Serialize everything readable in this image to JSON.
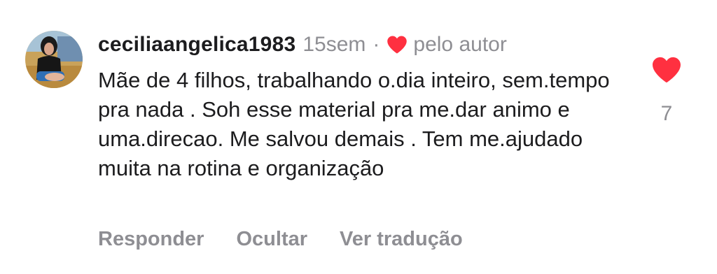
{
  "comment": {
    "username": "ceciliaangelica1983",
    "time": "15sem",
    "separator": "·",
    "liked_by_author": "pelo autor",
    "text": "Mãe de 4 filhos, trabalhando o.dia inteiro, sem.tempo pra nada . Soh esse material pra me.dar animo e uma.direcao. Me salvou demais . Tem me.ajudado muita na rotina e organização",
    "like_count": "7",
    "actions": {
      "reply": "Responder",
      "hide": "Ocultar",
      "translate": "Ver tradução"
    }
  },
  "colors": {
    "heart": "#ff3040",
    "meta": "#8e8e93",
    "text": "#1c1c1e"
  }
}
